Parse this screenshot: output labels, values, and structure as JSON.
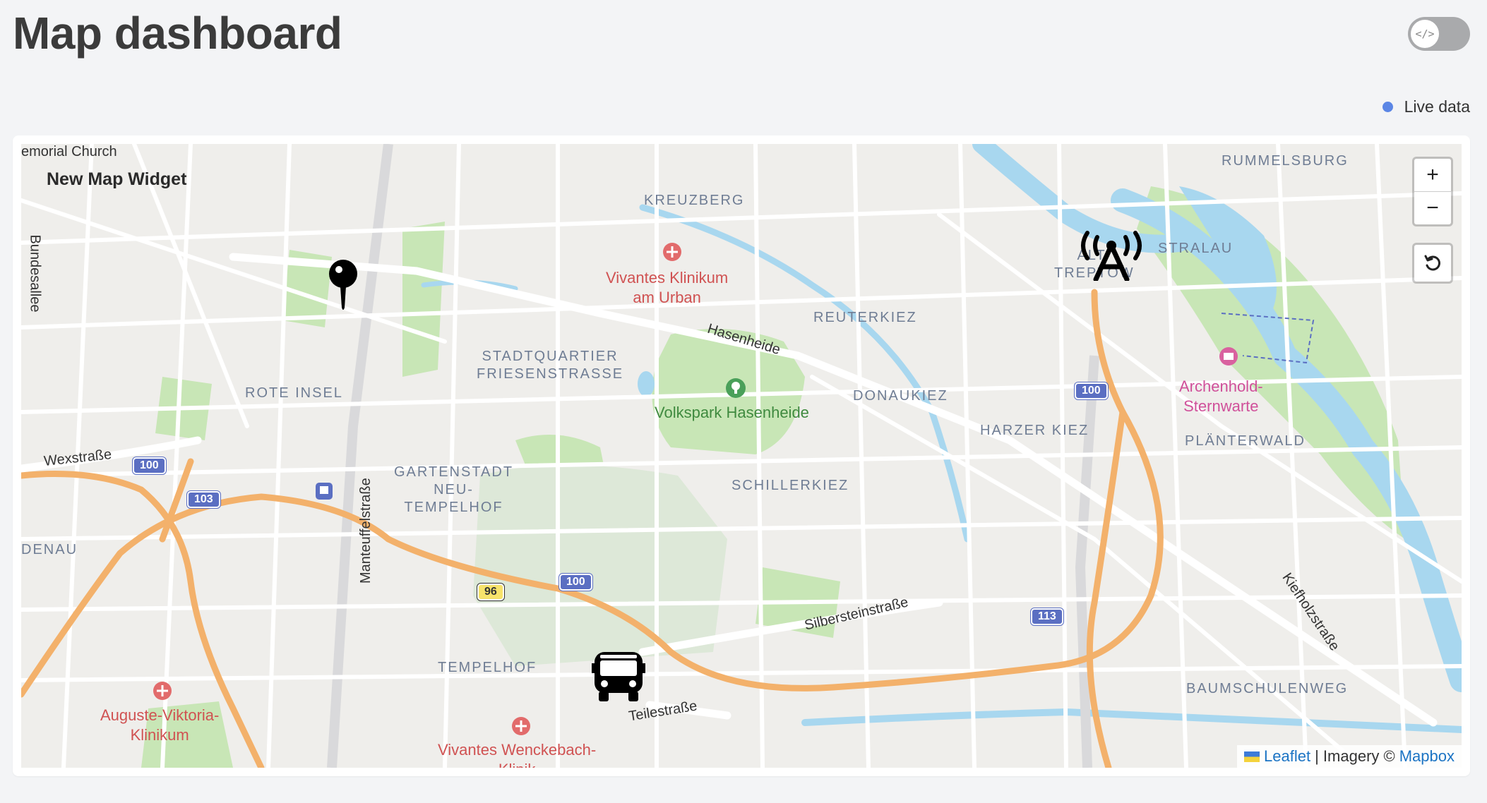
{
  "page": {
    "title": "Map dashboard",
    "toggle_icon": "</>"
  },
  "live": {
    "label": "Live data",
    "color": "#5b86e5"
  },
  "widget": {
    "title": "New Map Widget"
  },
  "map": {
    "districts": {
      "kreuzberg": "KREUZBERG",
      "rummelsburg": "RUMMELSBURG",
      "stralau": "STRALAU",
      "alt_treptow": "ALT-\nTREPTOW",
      "reuterkiez": "REUTERKIEZ",
      "stadtquartier": "STADTQUARTIER\nFRIESENSTRASSE",
      "rote_insel": "ROTE INSEL",
      "donaukiez": "DONAUKIEZ",
      "harzer_kiez": "HARZER KIEZ",
      "planterwald": "PLÄNTERWALD",
      "gartenstadt": "GARTENSTADT\nNEU-\nTEMPELHOF",
      "schillerkiez": "SCHILLERKIEZ",
      "denau": "DENAU",
      "tempelhof": "TEMPELHOF",
      "baumschulenweg": "BAUMSCHULENWEG"
    },
    "pois": {
      "vivantes_urban": "Vivantes Klinikum\nam Urban",
      "archenhold": "Archenhold-\nSternwarte",
      "volkspark": "Volkspark Hasenheide",
      "auguste": "Auguste-Viktoria-\nKlinikum",
      "wenckebach": "Vivantes Wenckebach-\nKlinik",
      "memorial": "emorial Church"
    },
    "streets": {
      "hasenheide": "Hasenheide",
      "wexstrasse": "Wexstraße",
      "bundesallee": "Bundesallee",
      "manteuffel": "Manteuffelstraße",
      "silberstein": "Silbersteinstraße",
      "teilestrasse": "Teilestraße",
      "kiefholz": "Kiefholzstraße"
    },
    "shields": {
      "a100_west": "100",
      "a103": "103",
      "a100_center": "100",
      "b96": "96",
      "a100_east": "100",
      "a113": "113"
    },
    "controls": {
      "zoom_in": "+",
      "zoom_out": "−"
    },
    "attribution": {
      "leaflet": "Leaflet",
      "separator": "| Imagery ©",
      "mapbox": "Mapbox"
    },
    "markers": {
      "pin": "map-pin-icon",
      "antenna": "antenna-icon",
      "bus": "bus-icon"
    },
    "colors": {
      "land": "#efeeeb",
      "park": "#c8e6b6",
      "water": "#a8d7ef",
      "highway": "#f3b16b",
      "road": "#ffffff"
    }
  }
}
